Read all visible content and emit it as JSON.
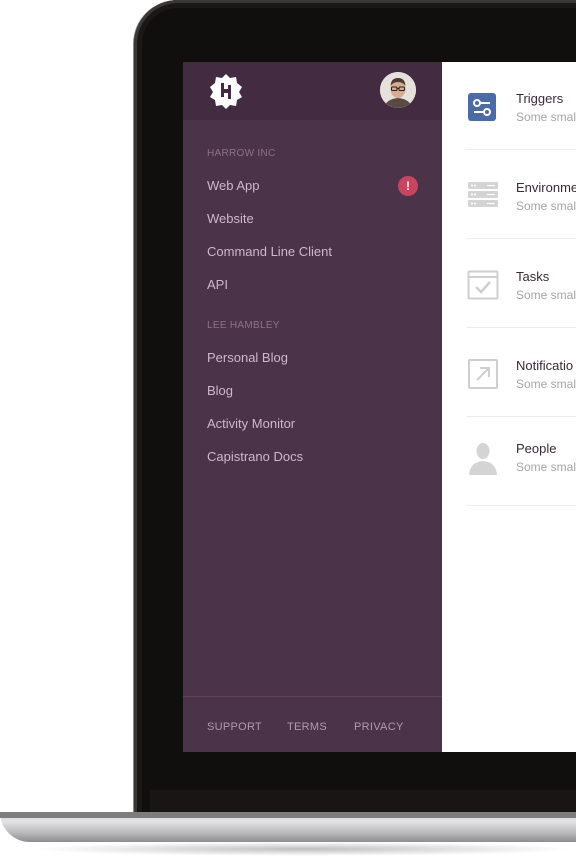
{
  "sidebar": {
    "sections": [
      {
        "title": "HARROW INC",
        "items": [
          {
            "label": "Web App",
            "alert": "!"
          },
          {
            "label": "Website"
          },
          {
            "label": "Command Line Client"
          },
          {
            "label": "API"
          }
        ]
      },
      {
        "title": "LEE HAMBLEY",
        "items": [
          {
            "label": "Personal Blog"
          },
          {
            "label": "Blog"
          },
          {
            "label": "Activity Monitor"
          },
          {
            "label": "Capistrano Docs"
          }
        ]
      }
    ],
    "footer": [
      "SUPPORT",
      "TERMS",
      "PRIVACY"
    ]
  },
  "main": {
    "rows": [
      {
        "title": "Triggers",
        "subtitle": "Some smal",
        "icon": "triggers-icon"
      },
      {
        "title": "Environme",
        "subtitle": "Some smal",
        "icon": "environment-icon"
      },
      {
        "title": "Tasks",
        "subtitle": "Some smal",
        "icon": "tasks-icon"
      },
      {
        "title": "Notificatio",
        "subtitle": "Some smal",
        "icon": "notification-icon"
      },
      {
        "title": "People",
        "subtitle": "Some smal",
        "icon": "people-icon"
      }
    ]
  },
  "colors": {
    "sidebar": "#4b3349",
    "sidebar_header": "#432c41",
    "alert": "#c9445e",
    "trigger_icon": "#4a6aa8"
  }
}
